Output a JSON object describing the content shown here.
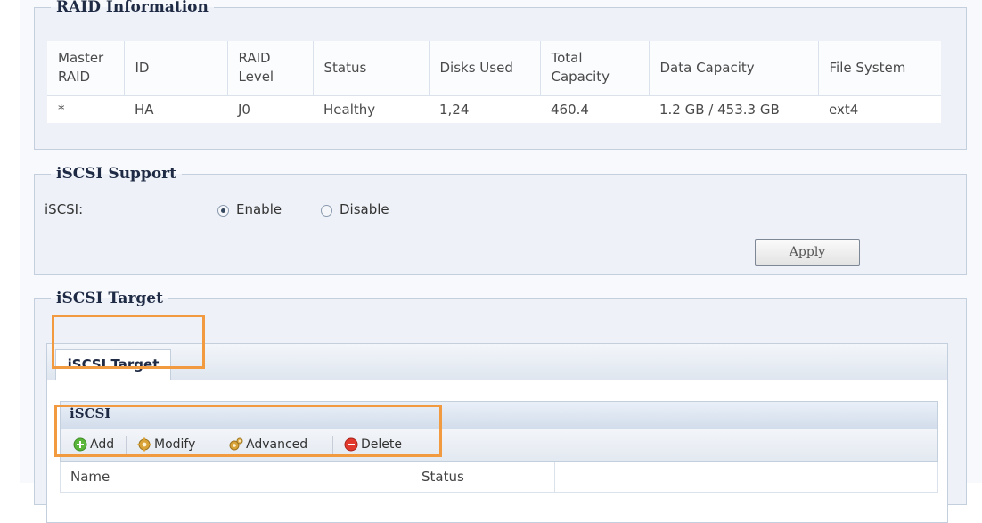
{
  "raid": {
    "legend": "RAID Information",
    "headers": [
      "Master RAID",
      "ID",
      "RAID Level",
      "Status",
      "Disks Used",
      "Total Capacity",
      "Data Capacity",
      "File System"
    ],
    "row": [
      "*",
      "HA",
      "J0",
      "Healthy",
      "1,24",
      "460.4",
      "1.2 GB / 453.3 GB",
      "ext4"
    ]
  },
  "support": {
    "legend": "iSCSI Support",
    "label": "iSCSI:",
    "enable_label": "Enable",
    "disable_label": "Disable",
    "selected": "Enable",
    "apply_label": "Apply"
  },
  "target": {
    "legend": "iSCSI Target",
    "tab_label": "iSCSI Target",
    "panel_title": "iSCSI",
    "toolbar": {
      "add": "Add",
      "modify": "Modify",
      "advanced": "Advanced",
      "delete": "Delete"
    },
    "columns": [
      "Name",
      "Status"
    ]
  },
  "colors": {
    "highlight": "#f19a3f",
    "add_icon": "#5ab63a",
    "delete_icon": "#e2392e",
    "gear_icon": "#d9a338"
  },
  "icons": {
    "add": "add-icon",
    "modify": "gear-icon",
    "advanced": "gears-icon",
    "delete": "delete-icon"
  }
}
